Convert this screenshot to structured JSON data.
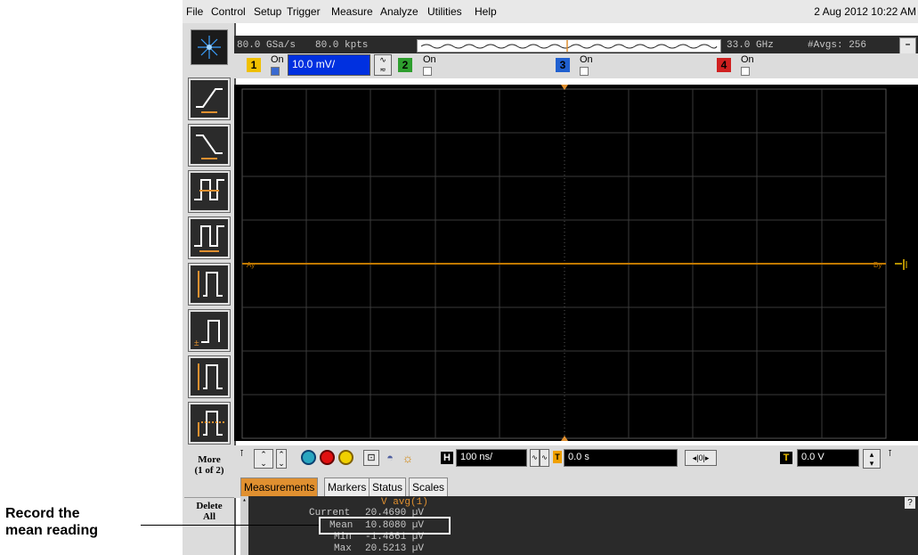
{
  "menubar": {
    "items": [
      "File",
      "Control",
      "Setup",
      "Trigger",
      "Measure",
      "Analyze",
      "Utilities",
      "Help"
    ],
    "datetime": "2 Aug 2012 10:22 AM"
  },
  "acquisition": {
    "sample_rate": "80.0 GSa/s",
    "memory_depth": "80.0 kpts",
    "bandwidth": "33.0 GHz",
    "averages": "#Avgs: 256"
  },
  "channels": [
    {
      "number": "1",
      "on_label": "On",
      "checked": true,
      "scale": "10.0 mV/",
      "color": "#f0c000"
    },
    {
      "number": "2",
      "on_label": "On",
      "checked": false,
      "color": "#2e9e2e"
    },
    {
      "number": "3",
      "on_label": "On",
      "checked": false,
      "color": "#2060d0"
    },
    {
      "number": "4",
      "on_label": "On",
      "checked": false,
      "color": "#d02020"
    }
  ],
  "graticule": {
    "trace_color": "#c07800",
    "grid_color": "#3a3a3a",
    "marker_a": "Ay",
    "marker_b": "By"
  },
  "sidebar": {
    "more_label": "More",
    "more_page": "(1 of 2)",
    "delete_all_label": "Delete All"
  },
  "horizontal": {
    "scale_label": "H",
    "time_per_div": "100 ns/",
    "delay": "0.0 s",
    "ref_position": "0"
  },
  "trigger": {
    "label": "T",
    "level": "0.0 V"
  },
  "tabs": [
    "Measurements",
    "Markers",
    "Status",
    "Scales"
  ],
  "measurement": {
    "title": "V avg(1)",
    "current_label": "Current",
    "current_value": "20.4690 µV",
    "mean_label": "Mean",
    "mean_value": "10.8080 µV",
    "min_label": "Min",
    "min_value": "-1.4861 µV",
    "max_label": "Max",
    "max_value": "20.5213 µV",
    "help": "?"
  },
  "annotation": {
    "line1": "Record the",
    "line2": "mean reading"
  }
}
